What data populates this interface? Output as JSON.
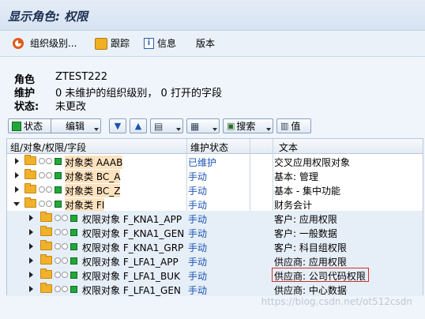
{
  "window": {
    "title": "显示角色: 权限"
  },
  "app_toolbar": {
    "org_levels_label": "组织级别...",
    "trace_label": "跟踪",
    "info_label": "信息",
    "version_label": "版本"
  },
  "header": {
    "role_key": "角色",
    "role_value": "ZTEST222",
    "maint_key": "维护",
    "maint_value": "0 未维护的组织级别，  0 打开的字段",
    "state_key": "状态:",
    "state_value": "未更改"
  },
  "alv_toolbar": {
    "status_label": "状态",
    "edit_label": "编辑",
    "search_label": "搜索",
    "value_label": "值"
  },
  "grid": {
    "columns": [
      "组/对象/权限/字段",
      "维护状态",
      "",
      "文本"
    ],
    "rows": [
      {
        "name": "对象类 AAAB",
        "status": "已维护",
        "text": "交叉应用权限对象"
      },
      {
        "name": "对象类 BC_A",
        "status": "手动",
        "text": "基本: 管理"
      },
      {
        "name": "对象类 BC_Z",
        "status": "手动",
        "text": "基本 - 集中功能"
      },
      {
        "name": "对象类 FI",
        "status": "手动",
        "text": "财务会计"
      },
      {
        "name": "权限对象 F_KNA1_APP",
        "status": "手动",
        "text": "客户: 应用权限"
      },
      {
        "name": "权限对象 F_KNA1_GEN",
        "status": "手动",
        "text": "客户: 一般数据"
      },
      {
        "name": "权限对象 F_KNA1_GRP",
        "status": "手动",
        "text": "客户: 科目组权限"
      },
      {
        "name": "权限对象 F_LFA1_APP",
        "status": "手动",
        "text": "供应商: 应用权限"
      },
      {
        "name": "权限对象 F_LFA1_BUK",
        "status": "手动",
        "text": "供应商: 公司代码权限"
      },
      {
        "name": "权限对象 F_LFA1_GEN",
        "status": "手动",
        "text": "供应商: 中心数据"
      }
    ]
  },
  "watermark": "https://blog.csdn.net/ot512csdn",
  "colors": {
    "status_blue": "#1a55b4",
    "maintained": "#1a55b4",
    "highlight_box": "#d0302a"
  }
}
